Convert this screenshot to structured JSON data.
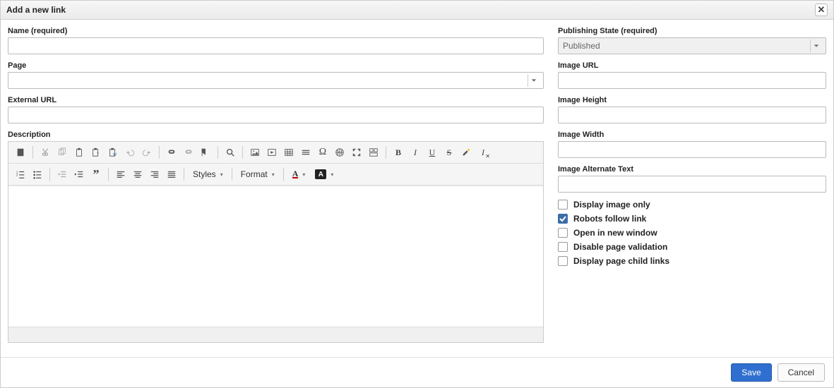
{
  "dialog": {
    "title": "Add a new link"
  },
  "left": {
    "name_label": "Name (required)",
    "name_value": "",
    "page_label": "Page",
    "page_value": "",
    "ext_url_label": "External URL",
    "ext_url_value": "",
    "description_label": "Description"
  },
  "right": {
    "pubstate_label": "Publishing State (required)",
    "pubstate_value": "Published",
    "img_url_label": "Image URL",
    "img_url_value": "",
    "img_h_label": "Image Height",
    "img_h_value": "",
    "img_w_label": "Image Width",
    "img_w_value": "",
    "img_alt_label": "Image Alternate Text",
    "img_alt_value": "",
    "chk_img_only": "Display image only",
    "chk_robots": "Robots follow link",
    "chk_newwin": "Open in new window",
    "chk_disable_val": "Disable page validation",
    "chk_child_links": "Display page child links"
  },
  "editor": {
    "styles_label": "Styles",
    "format_label": "Format"
  },
  "footer": {
    "save": "Save",
    "cancel": "Cancel"
  }
}
